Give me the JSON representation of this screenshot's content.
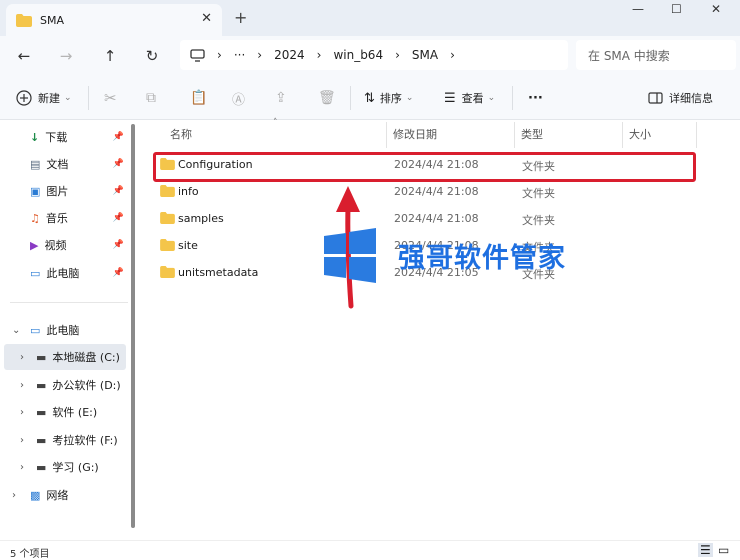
{
  "titlebar": {
    "tab_title": "SMA",
    "tab_close": "✕",
    "new_tab": "+",
    "minimize": "—",
    "maximize": "☐",
    "close": "✕"
  },
  "nav": {
    "back": "←",
    "forward": "→",
    "up": "↑",
    "refresh": "↻",
    "address_more": "···",
    "breadcrumbs": [
      "2024",
      "win_b64",
      "SMA"
    ],
    "search_placeholder": "在 SMA 中搜索"
  },
  "toolbar": {
    "new_label": "新建",
    "sort_label": "排序",
    "view_label": "查看",
    "more": "···",
    "details_label": "详细信息"
  },
  "sidebar": {
    "quick": [
      {
        "label": "下载",
        "icon": "download-icon"
      },
      {
        "label": "文档",
        "icon": "document-icon"
      },
      {
        "label": "图片",
        "icon": "pictures-icon"
      },
      {
        "label": "音乐",
        "icon": "music-icon"
      },
      {
        "label": "视频",
        "icon": "video-icon"
      },
      {
        "label": "此电脑",
        "icon": "computer-icon"
      }
    ],
    "tree_root": "此电脑",
    "drives": [
      {
        "label": "本地磁盘 (C:)",
        "selected": true
      },
      {
        "label": "办公软件 (D:)"
      },
      {
        "label": "软件 (E:)"
      },
      {
        "label": "考拉软件 (F:)"
      },
      {
        "label": "学习 (G:)"
      }
    ],
    "network": "网络"
  },
  "columns": {
    "name": "名称",
    "date": "修改日期",
    "type": "类型",
    "size": "大小"
  },
  "files": [
    {
      "name": "Configuration",
      "date": "2024/4/4 21:08",
      "type": "文件夹"
    },
    {
      "name": "info",
      "date": "2024/4/4 21:08",
      "type": "文件夹"
    },
    {
      "name": "samples",
      "date": "2024/4/4 21:08",
      "type": "文件夹"
    },
    {
      "name": "site",
      "date": "2024/4/4 21:08",
      "type": "文件夹"
    },
    {
      "name": "unitsmetadata",
      "date": "2024/4/4 21:05",
      "type": "文件夹"
    }
  ],
  "status": {
    "item_count": "5 个项目"
  },
  "watermark": {
    "text": "强哥软件管家"
  },
  "colors": {
    "highlight": "#d91e2e",
    "folder": "#f4c54a",
    "accent": "#1e6fe0"
  }
}
